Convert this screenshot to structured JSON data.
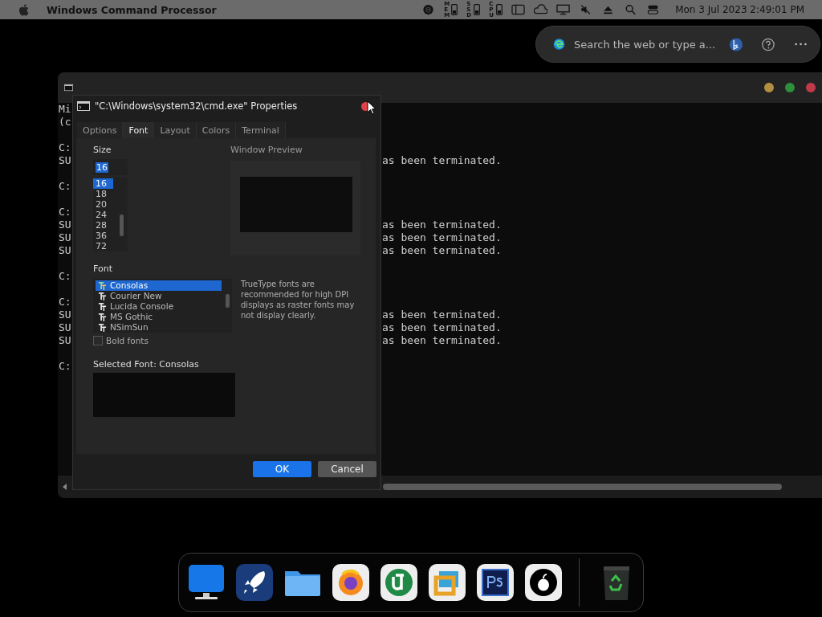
{
  "menu_bar": {
    "app_name": "Windows Command Processor",
    "meters": [
      {
        "label": "MEM"
      },
      {
        "label": "SSD"
      },
      {
        "label": "CPU"
      }
    ],
    "clock": "Mon 3 Jul 2023 2:49:01 PM"
  },
  "search": {
    "placeholder": "Search the web or type a..."
  },
  "terminal": {
    "blocks": [
      [
        {
          "left": "Mi"
        },
        {
          "left": "(c"
        }
      ],
      [
        {
          "left": "C:"
        },
        {
          "left": "SU",
          "right": "as been terminated."
        }
      ],
      [
        {
          "left": "C:"
        }
      ],
      [
        {
          "left": "C:"
        },
        {
          "left": "SU",
          "right": "as been terminated."
        },
        {
          "left": "SU",
          "right": "as been terminated."
        },
        {
          "left": "SU",
          "right": "as been terminated."
        }
      ],
      [
        {
          "left": "C:"
        }
      ],
      [
        {
          "left": "C:"
        },
        {
          "left": "SU",
          "right": "as been terminated."
        },
        {
          "left": "SU",
          "right": "as been terminated."
        },
        {
          "left": "SU",
          "right": "as been terminated."
        }
      ],
      [
        {
          "left": "C:"
        }
      ]
    ]
  },
  "dialog": {
    "title": "\"C:\\Windows\\system32\\cmd.exe\" Properties",
    "tabs": [
      {
        "label": "Options",
        "selected": false
      },
      {
        "label": "Font",
        "selected": true
      },
      {
        "label": "Layout",
        "selected": false
      },
      {
        "label": "Colors",
        "selected": false
      },
      {
        "label": "Terminal",
        "selected": false
      }
    ],
    "size": {
      "label": "Size",
      "value": "16",
      "options": [
        {
          "label": "16",
          "selected": true
        },
        {
          "label": "18",
          "selected": false
        },
        {
          "label": "20",
          "selected": false
        },
        {
          "label": "24",
          "selected": false
        },
        {
          "label": "28",
          "selected": false
        },
        {
          "label": "36",
          "selected": false
        },
        {
          "label": "72",
          "selected": false
        }
      ]
    },
    "preview_label": "Window Preview",
    "font": {
      "label": "Font",
      "options": [
        {
          "label": "Consolas",
          "selected": true
        },
        {
          "label": "Courier New",
          "selected": false
        },
        {
          "label": "Lucida Console",
          "selected": false
        },
        {
          "label": "MS Gothic",
          "selected": false
        },
        {
          "label": "NSimSun",
          "selected": false
        }
      ]
    },
    "note": "TrueType fonts are recommended for high DPI displays as raster fonts may not display clearly.",
    "bold": {
      "label": "Bold fonts",
      "checked": false
    },
    "selected_font_label": "Selected Font: Consolas",
    "buttons": [
      {
        "label": "OK",
        "kind": "primary"
      },
      {
        "label": "Cancel",
        "kind": "secondary"
      }
    ]
  }
}
